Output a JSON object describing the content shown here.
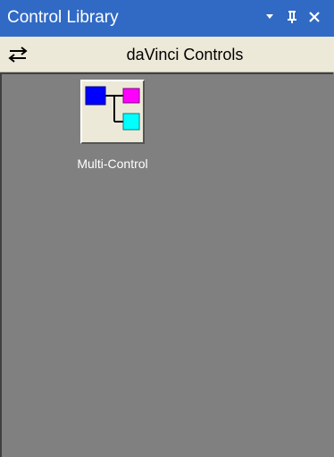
{
  "window": {
    "title": "Control Library",
    "title_bar_color": "#316ac5",
    "buttons": [
      {
        "name": "dropdown",
        "icon": "triangle-down-icon"
      },
      {
        "name": "pin",
        "icon": "pin-icon"
      },
      {
        "name": "close",
        "icon": "close-icon"
      }
    ]
  },
  "header": {
    "title": "daVinci Controls",
    "swap_icon": "swap-arrows-icon"
  },
  "content": {
    "background": "#808080",
    "items": [
      {
        "label": "Multi-Control",
        "icon": "multi-control-icon",
        "icon_colors": [
          "#0000ff",
          "#ff00ff",
          "#00ffff"
        ]
      }
    ]
  }
}
